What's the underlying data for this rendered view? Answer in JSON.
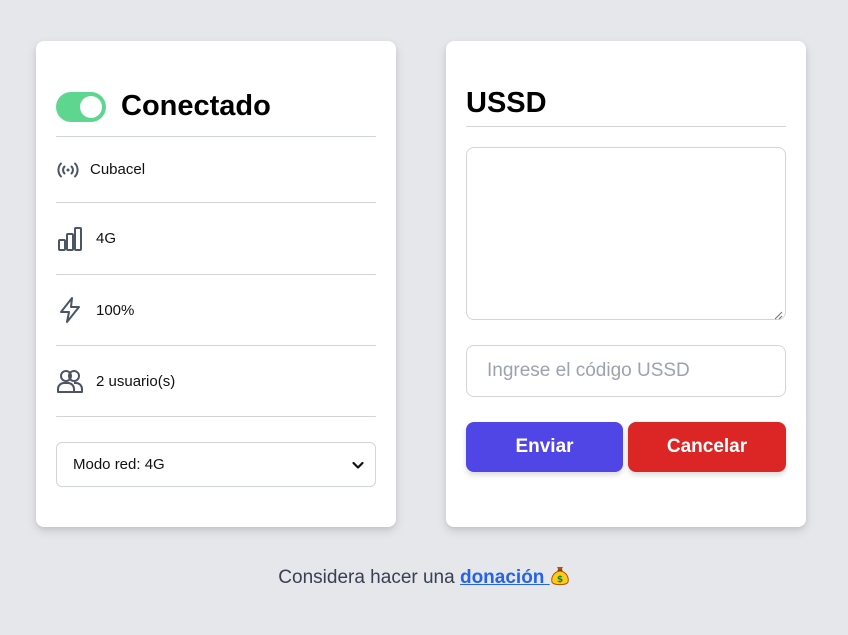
{
  "status": {
    "toggle_on": true,
    "title": "Conectado"
  },
  "info": {
    "operator": "Cubacel",
    "network": "4G",
    "battery": "100%",
    "users": "2 usuario(s)"
  },
  "network_mode": {
    "selected": "Modo red: 4G"
  },
  "ussd": {
    "title": "USSD",
    "textarea_value": "",
    "input_placeholder": "Ingrese el código USSD",
    "send_label": "Enviar",
    "cancel_label": "Cancelar"
  },
  "footer": {
    "text": "Considera hacer una ",
    "link_text": "donación",
    "icon": "money-bag-icon"
  },
  "colors": {
    "toggle": "#5fd68f",
    "send": "#4f46e5",
    "cancel": "#dc2626",
    "link": "#2563eb"
  }
}
